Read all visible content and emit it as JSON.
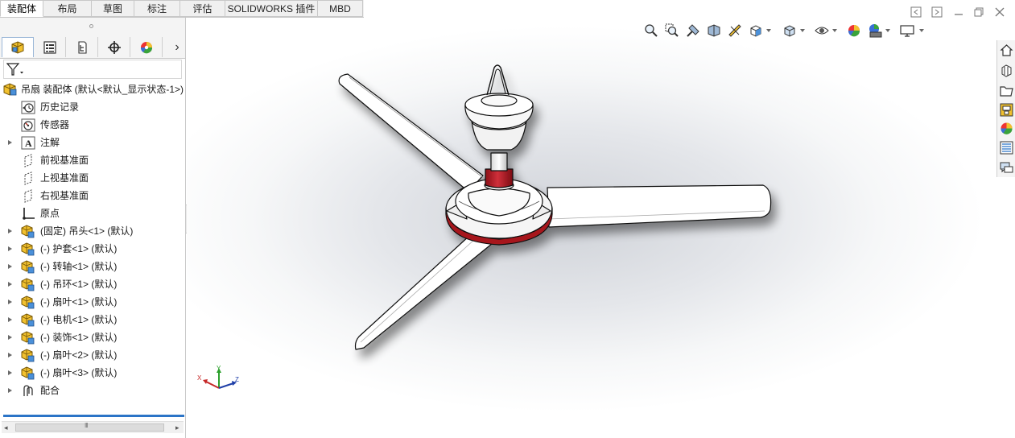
{
  "tabs": [
    {
      "label": "装配体",
      "active": true
    },
    {
      "label": "布局",
      "active": false
    },
    {
      "label": "草图",
      "active": false
    },
    {
      "label": "标注",
      "active": false
    },
    {
      "label": "评估",
      "active": false
    },
    {
      "label": "SOLIDWORKS 插件",
      "active": false
    },
    {
      "label": "MBD",
      "active": false
    }
  ],
  "panel_tabs": [
    "featuremanager-icon",
    "propertymanager-icon",
    "configurationmanager-icon",
    "dimxpert-icon",
    "displaymanager-icon"
  ],
  "panel_more": "›",
  "filter_icon": "filter-icon",
  "tree": {
    "root": "吊扇 装配体 (默认<默认_显示状态-1>)",
    "items": [
      {
        "label": "历史记录",
        "icon": "history-icon",
        "expandable": false
      },
      {
        "label": "传感器",
        "icon": "sensor-icon",
        "expandable": false
      },
      {
        "label": "注解",
        "icon": "annotation-icon",
        "expandable": true
      },
      {
        "label": "前视基准面",
        "icon": "plane-icon",
        "expandable": false
      },
      {
        "label": "上视基准面",
        "icon": "plane-icon",
        "expandable": false
      },
      {
        "label": "右视基准面",
        "icon": "plane-icon",
        "expandable": false
      },
      {
        "label": "原点",
        "icon": "origin-icon",
        "expandable": false
      },
      {
        "label": "(固定) 吊头<1> (默认)",
        "icon": "part-icon",
        "expandable": true
      },
      {
        "label": "(-) 护套<1> (默认)",
        "icon": "part-icon",
        "expandable": true
      },
      {
        "label": "(-) 转轴<1> (默认)",
        "icon": "part-icon",
        "expandable": true
      },
      {
        "label": "(-) 吊环<1> (默认)",
        "icon": "part-icon",
        "expandable": true
      },
      {
        "label": "(-) 扇叶<1> (默认)",
        "icon": "part-icon",
        "expandable": true
      },
      {
        "label": "(-) 电机<1> (默认)",
        "icon": "part-icon",
        "expandable": true
      },
      {
        "label": "(-) 装饰<1> (默认)",
        "icon": "part-icon",
        "expandable": true
      },
      {
        "label": "(-) 扇叶<2> (默认)",
        "icon": "part-icon",
        "expandable": true
      },
      {
        "label": "(-) 扇叶<3> (默认)",
        "icon": "part-icon",
        "expandable": true
      },
      {
        "label": "配合",
        "icon": "mates-icon",
        "expandable": true
      }
    ]
  },
  "hscroll": {
    "left": "◂",
    "grip": "III",
    "right": "▸"
  },
  "triad": {
    "x": "X",
    "y": "Y",
    "z": "Z"
  },
  "colors": {
    "accent": "#2b74c7",
    "motor_red": "#b01822",
    "tab_border": "#c8c8c8"
  }
}
